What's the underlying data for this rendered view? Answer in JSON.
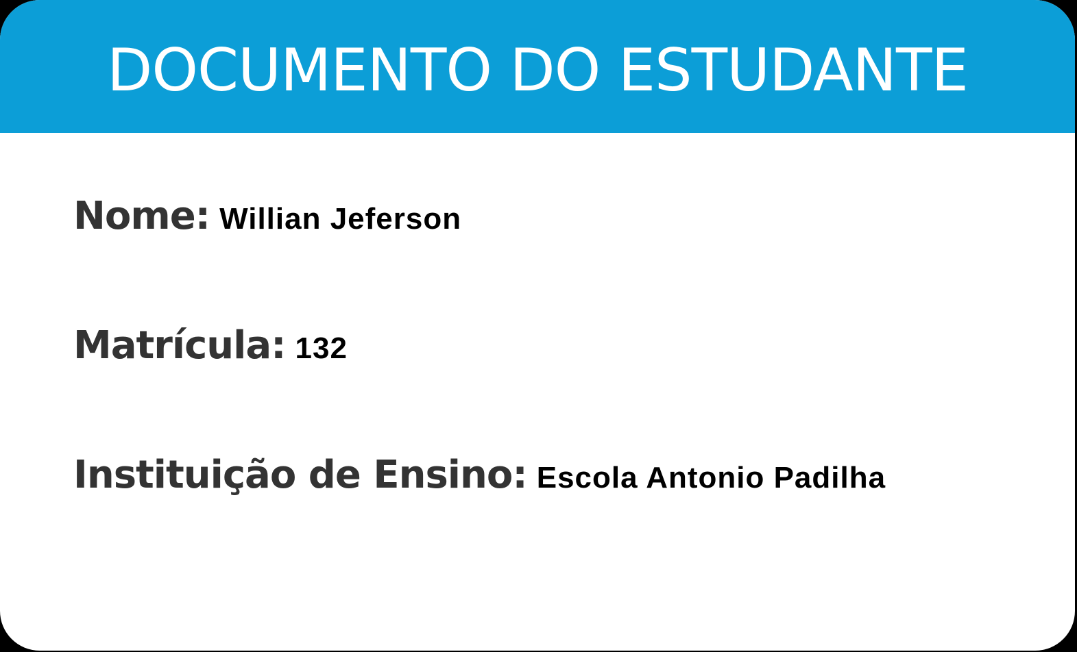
{
  "header": {
    "title": "DOCUMENTO DO ESTUDANTE",
    "background_color": "#0c9ed7",
    "text_color": "#ffffff"
  },
  "fields": {
    "name": {
      "label": "Nome:",
      "value": "Willian Jeferson"
    },
    "registration": {
      "label": "Matrícula:",
      "value": "132"
    },
    "institution": {
      "label": "Instituição de Ensino:",
      "value": "Escola Antonio Padilha"
    }
  },
  "colors": {
    "label": "#333333",
    "value": "#000000",
    "card_background": "#ffffff"
  }
}
